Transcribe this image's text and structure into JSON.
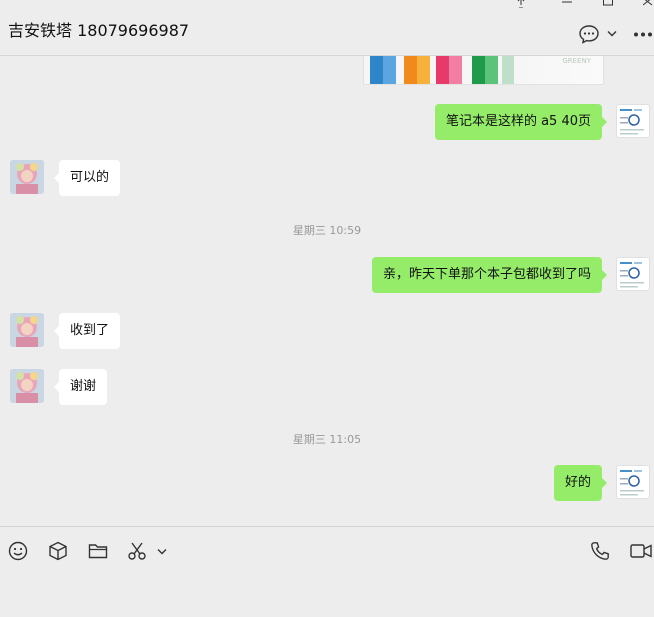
{
  "window": {
    "title": "吉安铁塔 18079696987",
    "controls": [
      "pin-icon",
      "minimize-icon",
      "maximize-icon",
      "close-icon"
    ]
  },
  "header_actions": [
    "chat-bubble-icon",
    "chevron-down-icon",
    "more-icon"
  ],
  "messages": [
    {
      "type": "image",
      "side": "right",
      "brand": "GREENY"
    },
    {
      "type": "text",
      "side": "right",
      "text": "笔记本是这样的 a5 40页"
    },
    {
      "type": "text",
      "side": "left",
      "text": "可以的"
    },
    {
      "type": "time",
      "text": "星期三 10:59"
    },
    {
      "type": "text",
      "side": "right",
      "text": "亲，昨天下单那个本子包都收到了吗"
    },
    {
      "type": "text",
      "side": "left",
      "text": "收到了"
    },
    {
      "type": "text",
      "side": "left",
      "text": "谢谢"
    },
    {
      "type": "time",
      "text": "星期三 11:05"
    },
    {
      "type": "text",
      "side": "right",
      "text": "好的"
    }
  ],
  "toolbar": {
    "left": [
      "emoji-icon",
      "cube-icon",
      "folder-icon",
      "scissors-icon",
      "chevron-down-icon"
    ],
    "right": [
      "phone-icon",
      "video-icon"
    ]
  },
  "colors": {
    "background": "#ededed",
    "bubble_self": "#95ec69",
    "bubble_other": "#ffffff",
    "timestamp": "#999999"
  }
}
